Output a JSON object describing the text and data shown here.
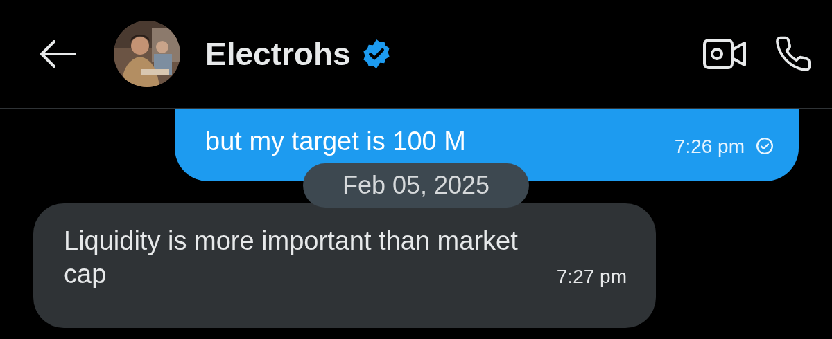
{
  "header": {
    "title": "Electrohs",
    "verified": true
  },
  "messages": [
    {
      "kind": "outgoing",
      "text": "but my target is 100 M",
      "time": "7:26 pm",
      "read": true
    },
    {
      "kind": "date",
      "text": "Feb 05, 2025"
    },
    {
      "kind": "incoming",
      "text": "Liquidity is more important than market cap",
      "time": "7:27 pm"
    }
  ]
}
